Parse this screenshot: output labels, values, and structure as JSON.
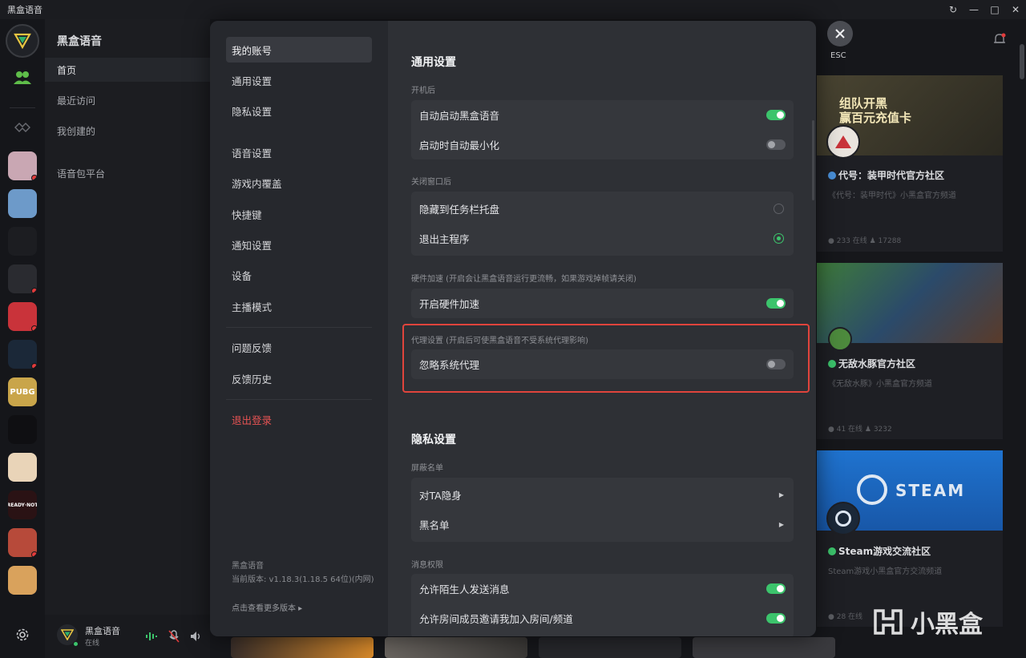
{
  "app": {
    "title": "黑盒语音"
  },
  "window": {
    "controls": [
      "↻",
      "—",
      "□",
      "✕"
    ]
  },
  "rail": {
    "games": [
      {
        "name": "anime-game",
        "color": "#c9a7b3",
        "label": "",
        "dot": true
      },
      {
        "name": "pokemon",
        "color": "#6d9ac9",
        "label": "",
        "dot": false
      },
      {
        "name": "heybox",
        "color": "#1c1d21",
        "label": "",
        "dot": false
      },
      {
        "name": "destiny",
        "color": "#2a2b30",
        "label": "",
        "dot": true
      },
      {
        "name": "valorant",
        "color": "#c9333a",
        "label": "",
        "dot": true
      },
      {
        "name": "steam",
        "color": "#1b2838",
        "label": "",
        "dot": true
      },
      {
        "name": "pubg",
        "color": "#c9a54a",
        "label": "PUBG",
        "dot": false
      },
      {
        "name": "penguin",
        "color": "#0f0f12",
        "label": "",
        "dot": false
      },
      {
        "name": "cat-game",
        "color": "#e9d4b8",
        "label": "",
        "dot": false
      },
      {
        "name": "ready-or-not",
        "color": "#2a1214",
        "label": "READY·NOT",
        "dot": false
      },
      {
        "name": "dog-game",
        "color": "#b74a3a",
        "label": "",
        "dot": true
      },
      {
        "name": "shiba-game",
        "color": "#d9a25c",
        "label": "",
        "dot": false
      }
    ]
  },
  "leftnav": {
    "title": "黑盒语音",
    "items": [
      "首页",
      "最近访问",
      "我创建的",
      "语音包平台"
    ],
    "user": {
      "name": "黑盒语音",
      "status": "在线"
    }
  },
  "modal": {
    "nav": {
      "my_account": "我的账号",
      "general": "通用设置",
      "privacy": "隐私设置",
      "voice": "语音设置",
      "overlay": "游戏内覆盖",
      "hotkeys": "快捷键",
      "notifications": "通知设置",
      "devices": "设备",
      "streamer": "主播模式",
      "feedback": "问题反馈",
      "feedback_history": "反馈历史",
      "logout": "退出登录"
    },
    "version": {
      "app_name": "黑盒语音",
      "current": "当前版本: v1.18.3(1.18.5 64位)(内网)",
      "more_link": "点击查看更多版本 ▸"
    },
    "general": {
      "title": "通用设置",
      "startup_label": "开机后",
      "auto_start": "自动启动黑盒语音",
      "auto_minimize": "启动时自动最小化",
      "close_label": "关闭窗口后",
      "hide_tray": "隐藏到任务栏托盘",
      "exit_program": "退出主程序",
      "hw_label": "硬件加速 (开启会让黑盒语音运行更流畅，如果游戏掉帧请关闭)",
      "hw_enable": "开启硬件加速",
      "proxy_label": "代理设置 (开启后可使黑盒语音不受系统代理影响)",
      "proxy_ignore": "忽略系统代理"
    },
    "privacy": {
      "title": "隐私设置",
      "block_label": "屏蔽名单",
      "invisible": "对TA隐身",
      "blacklist": "黑名单",
      "msg_label": "消息权限",
      "allow_strangers": "允许陌生人发送消息",
      "allow_room_invite": "允许房间成员邀请我加入房间/频道"
    },
    "settings_state": {
      "auto_start": true,
      "auto_minimize": false,
      "close_action": "exit",
      "hw_accel": true,
      "ignore_proxy": false,
      "allow_strangers": true,
      "allow_room_invite": true
    },
    "esc_label": "ESC"
  },
  "background": {
    "cards": [
      {
        "banner_text": "组队开黑\n赢百元充值卡",
        "title": "代号：装甲时代官方社区",
        "desc": "《代号：装甲时代》小黑盒官方频道",
        "stats": "● 233 在线  ♟ 17288",
        "banner_color": "#3d3a2c",
        "verified": "blue"
      },
      {
        "banner_text": "",
        "title": "无敌水豚官方社区",
        "desc": "《无敌水豚》小黑盒官方频道",
        "stats": "● 41 在线  ♟ 3232",
        "banner_color": "#3b6a3a",
        "verified": "green"
      },
      {
        "banner_text": "STEAM",
        "title": "Steam游戏交流社区",
        "desc": "Steam游戏小黑盒官方交流频道",
        "stats": "● 28 在线",
        "banner_color": "#1b6fc9",
        "verified": "green"
      }
    ],
    "watermark": "小黑盒"
  }
}
